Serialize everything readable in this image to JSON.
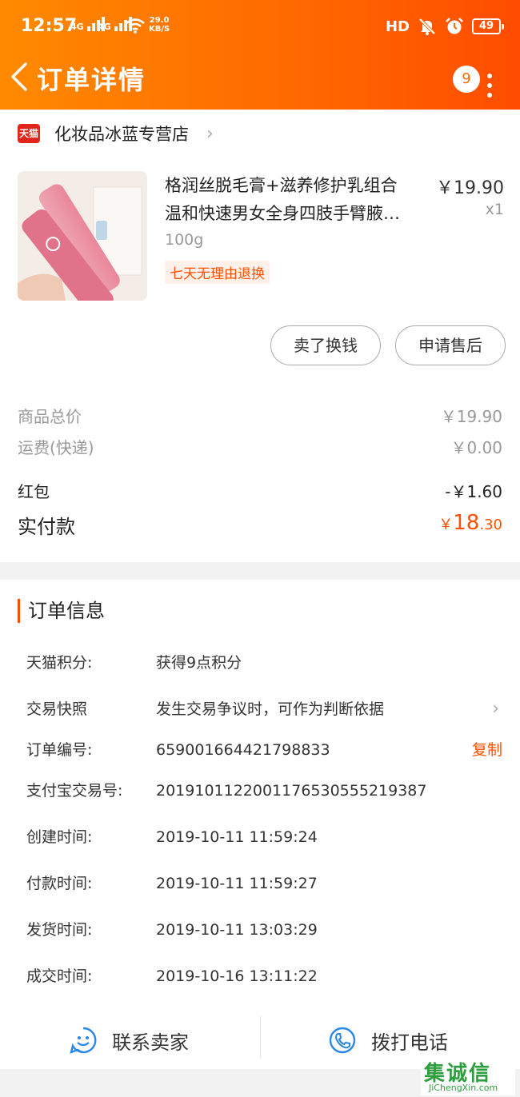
{
  "status_bar": {
    "time": "12:57",
    "net1": "4G",
    "net2": "4G",
    "speed_value": "29.0",
    "speed_unit": "KB/S",
    "hd": "HD",
    "battery": "49"
  },
  "header": {
    "title": "订单详情",
    "badge": "9"
  },
  "store": {
    "logo_text": "天猫",
    "name": "化妆品冰蓝专营店"
  },
  "product": {
    "title_line1": "格润丝脱毛膏+滋养修护乳组合",
    "title_line2": "温和快速男女全身四肢手臂腋…",
    "price": "￥19.90",
    "quantity": "x1",
    "spec": "100g",
    "tag": "七天无理由退换"
  },
  "actions": {
    "sell_label": "卖了换钱",
    "after_sale_label": "申请售后"
  },
  "summary": {
    "goods_total_label": "商品总价",
    "goods_total_value": "￥19.90",
    "shipping_label": "运费(快递)",
    "shipping_value": "￥0.00",
    "red_packet_label": "红包",
    "red_packet_value": "-￥1.60",
    "paid_label": "实付款",
    "paid_currency": "￥",
    "paid_int": "18",
    "paid_dec": ".30"
  },
  "order_info": {
    "section_title": "订单信息",
    "points_label": "天猫积分:",
    "points_value": "获得9点积分",
    "snapshot_label": "交易快照",
    "snapshot_value": "发生交易争议时，可作为判断依据",
    "order_no_label": "订单编号:",
    "order_no_value": "659001664421798833",
    "copy_label": "复制",
    "alipay_label": "支付宝交易号:",
    "alipay_value": "2019101122001176530555219387",
    "created_label": "创建时间:",
    "created_value": "2019-10-11 11:59:24",
    "paid_time_label": "付款时间:",
    "paid_time_value": "2019-10-11 11:59:27",
    "shipped_label": "发货时间:",
    "shipped_value": "2019-10-11 13:03:29",
    "closed_label": "成交时间:",
    "closed_value": "2019-10-16 13:11:22"
  },
  "bottom_bar": {
    "contact_label": "联系卖家",
    "call_label": "拨打电话"
  },
  "watermark": {
    "zh": "集诚信",
    "en": "JiChengXin.com"
  },
  "colors": {
    "accent": "#ff5000",
    "header_start": "#ff8a00",
    "header_end": "#ff4c00",
    "icon_blue": "#2a86e8",
    "tmall_red": "#e1251b"
  }
}
